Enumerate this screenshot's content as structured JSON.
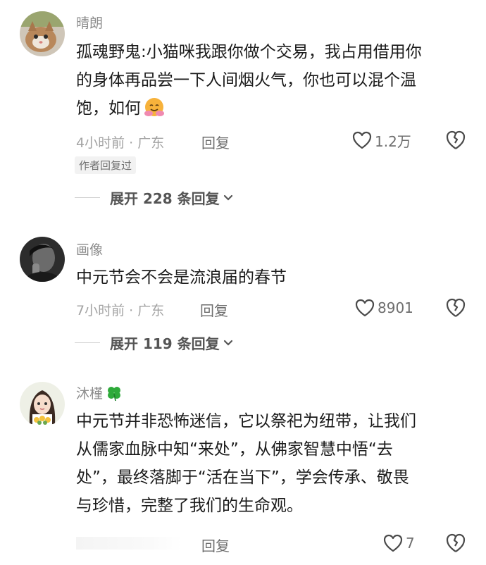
{
  "comments": [
    {
      "username": "晴朗",
      "lines": [
        "孤魂野鬼:小猫咪我跟你做个交易，我占用借用你",
        "的身体再品尝一下人间烟火气，你也可以混个温",
        "饱，如何"
      ],
      "emoji": "hugging-face-emoji",
      "meta": "4小时前 · 广东",
      "reply_label": "回复",
      "likes": "1.2万",
      "author_tag": "作者回复过",
      "expand_label": "展开 228 条回复"
    },
    {
      "username": "画像",
      "lines": [
        "中元节会不会是流浪届的春节"
      ],
      "meta": "7小时前 · 广东",
      "reply_label": "回复",
      "likes": "8901",
      "expand_label": "展开 119 条回复"
    },
    {
      "username": "沐槿",
      "username_icon": "four-leaf-clover-icon",
      "lines": [
        "中元节并非恐怖迷信，它以祭祀为纽带，让我们",
        "从儒家血脉中知“来处”，从佛家智慧中悟“去",
        "处”，最终落脚于“活在当下”，学会传承、敬畏",
        "与珍惜，完整了我们的生命观。"
      ],
      "reply_label": "回复",
      "likes": "7"
    }
  ],
  "colors": {
    "text": "#1b1b1b",
    "muted": "#a3a3a3",
    "accent_green": "#2eaa3a"
  }
}
